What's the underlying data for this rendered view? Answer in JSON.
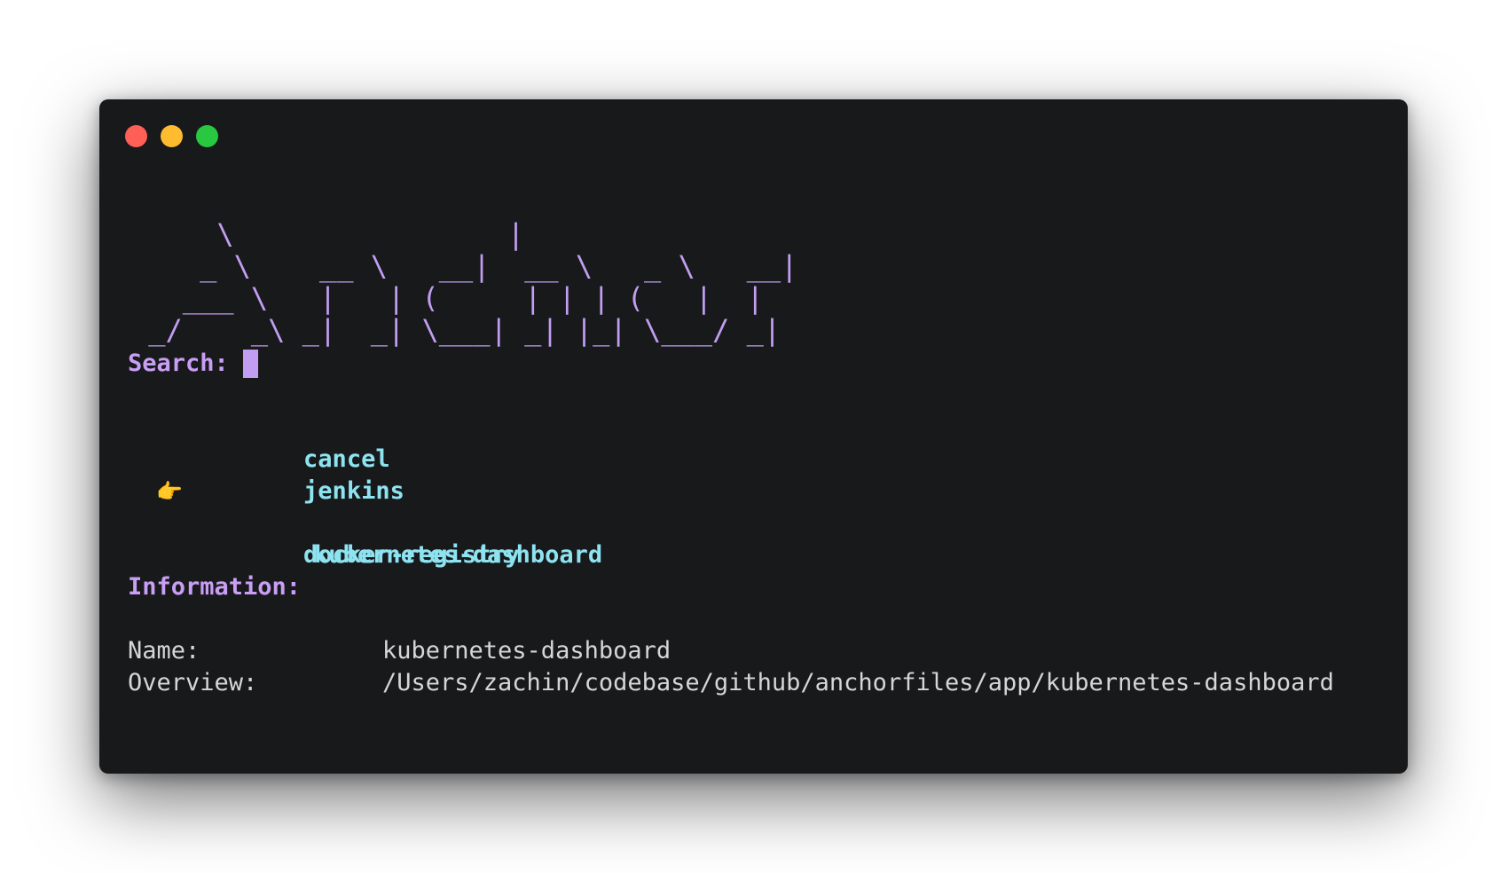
{
  "window": {
    "controls": [
      "close",
      "minimize",
      "zoom"
    ]
  },
  "banner": {
    "text": "     \\                |\n    _ \\    __ \\   __|  __ \\   _ \\   __|\n   ___ \\   |   | (     | | | (   |  |\n _/    _\\ _|  _| \\___| _| |_| \\___/ _|"
  },
  "search": {
    "label": "Search:",
    "value": ""
  },
  "menu": {
    "pointer": "👉",
    "items": [
      {
        "label": "cancel"
      },
      {
        "label": "jenkins"
      },
      {
        "label": "kubernetes-dashboard",
        "selected": true
      },
      {
        "label": "docker-registry"
      }
    ]
  },
  "information": {
    "title": "Information:",
    "rows": [
      {
        "key": "Name:",
        "value": "kubernetes-dashboard"
      },
      {
        "key": "Overview:",
        "value": "/Users/zachin/codebase/github/anchorfiles/app/kubernetes-dashboard"
      }
    ]
  },
  "colors": {
    "background": "#18191b",
    "accent_purple": "#c29ef2",
    "item_cyan": "#8ee3f0",
    "text": "#d6d6d6",
    "pointer_yellow": "#f4c64a"
  }
}
